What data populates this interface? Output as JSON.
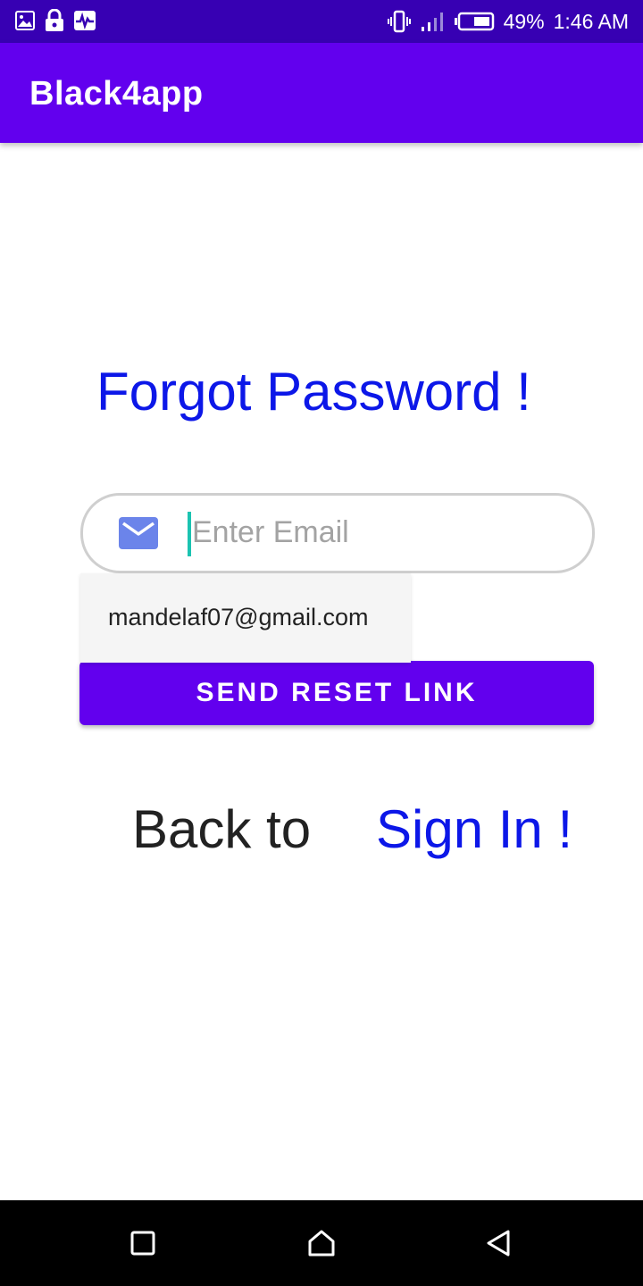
{
  "status_bar": {
    "battery": "49%",
    "time": "1:46 AM",
    "icons_left": [
      "image-icon",
      "lock-icon",
      "activity-icon"
    ],
    "icons_right": [
      "vibrate-icon",
      "signal-icon",
      "battery-icon"
    ]
  },
  "app_bar": {
    "title": "Black4app"
  },
  "main": {
    "heading": "Forgot Password !",
    "email_field": {
      "icon": "mail-icon",
      "value": "",
      "placeholder": "Enter Email"
    },
    "autofill_suggestion": "mandelaf07@gmail.com",
    "send_button_label": "SEND RESET LINK",
    "back_text": "Back to",
    "sign_in_link": "Sign In !"
  },
  "nav_bar": {
    "buttons": [
      "recents-icon",
      "home-icon",
      "back-icon"
    ]
  },
  "colors": {
    "primary": "#6200ee",
    "primary_dark": "#3700b3",
    "link_blue": "#0c17e8",
    "caret": "#1bc3b1"
  }
}
